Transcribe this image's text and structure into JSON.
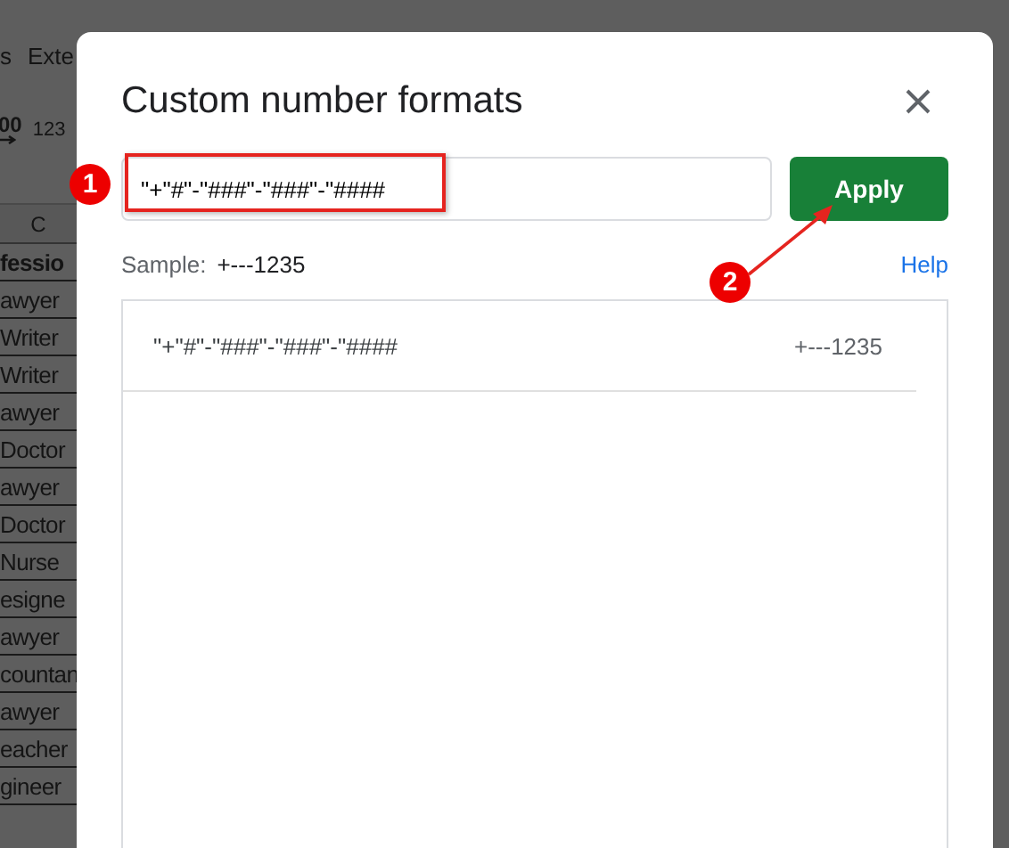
{
  "background_sheet": {
    "menu": [
      "s",
      "Exte"
    ],
    "toolbar": [
      "00",
      "123"
    ],
    "column_header": "C",
    "header_cell": "fessio",
    "cells": [
      "awyer",
      "Writer",
      "Writer",
      "awyer",
      "Doctor",
      "awyer",
      "Doctor",
      "Nurse",
      "esigne",
      "awyer",
      "countan",
      "awyer",
      "eacher",
      "gineer"
    ]
  },
  "dialog": {
    "title": "Custom number formats",
    "format_input": {
      "value": "\"+\"#\"-\"###\"-\"###\"-\"####"
    },
    "apply_button": "Apply",
    "sample_label": "Sample:",
    "sample_value": "+---1235",
    "help_link": "Help",
    "formats": [
      {
        "format": "\"+\"#\"-\"###\"-\"###\"-\"####",
        "sample": "+---1235"
      }
    ]
  },
  "annotations": [
    {
      "number": "1"
    },
    {
      "number": "2"
    }
  ]
}
